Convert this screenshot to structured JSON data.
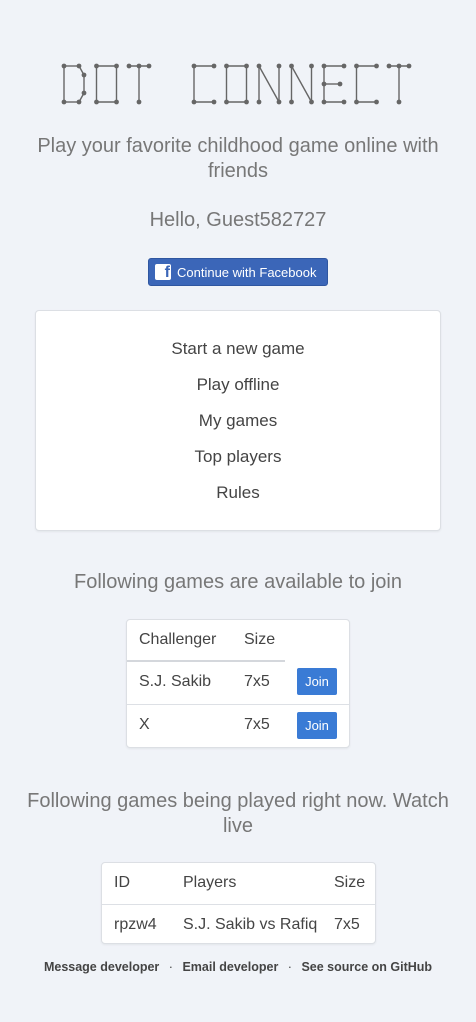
{
  "logo": {
    "text": "DOT CONNECT"
  },
  "tagline": "Play your favorite childhood game online with friends",
  "greeting": "Hello, Guest582727",
  "facebook_button": {
    "label": "Continue with Facebook",
    "icon": "facebook-icon",
    "color": "#3b66b8"
  },
  "menu": {
    "items": [
      {
        "label": "Start a new game"
      },
      {
        "label": "Play offline"
      },
      {
        "label": "My games"
      },
      {
        "label": "Top players"
      },
      {
        "label": "Rules"
      }
    ]
  },
  "join_section": {
    "title": "Following games are available to join",
    "columns": [
      "Challenger",
      "Size"
    ],
    "rows": [
      {
        "challenger": "S.J. Sakib",
        "size": "7x5",
        "action": "Join"
      },
      {
        "challenger": "X",
        "size": "7x5",
        "action": "Join"
      }
    ],
    "button_color": "#3a7bd5"
  },
  "live_section": {
    "title": "Following games being played right now. Watch live",
    "columns": [
      "ID",
      "Players",
      "Size"
    ],
    "rows": [
      {
        "id": "rpzw4",
        "players": "S.J. Sakib vs Rafiq",
        "size": "7x5"
      }
    ]
  },
  "footer": {
    "links": [
      "Message developer",
      "Email developer",
      "See source on GitHub"
    ],
    "separator": "·"
  },
  "colors": {
    "background": "#f0f3f8",
    "text": "#777777"
  }
}
